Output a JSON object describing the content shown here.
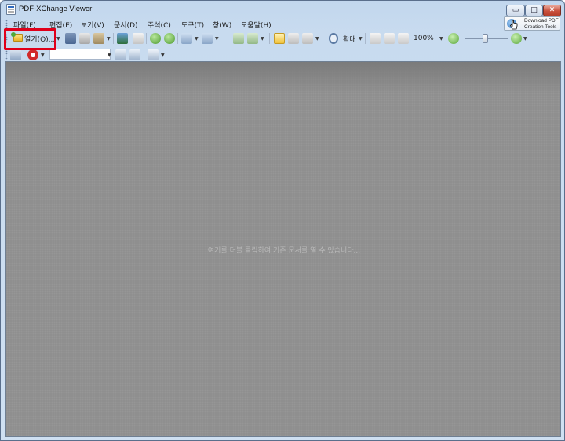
{
  "window": {
    "title": "PDF-XChange Viewer",
    "min_symbol": "▭",
    "max_symbol": "□",
    "close_symbol": "✕"
  },
  "promo": {
    "text": "Download PDF Creation Tools"
  },
  "menu": {
    "items": [
      "파일(F)",
      "편집(E)",
      "보기(V)",
      "문서(D)",
      "주석(C)",
      "도구(T)",
      "창(W)",
      "도움말(H)"
    ]
  },
  "toolbar": {
    "open_label": "열기(O)...",
    "zoom_tool_label": "확대",
    "zoom_value": "100%",
    "search_value": ""
  },
  "workspace": {
    "hint": "여기를 더블 클릭하여 기존 문서를 열 수 있습니다..."
  },
  "colors": {
    "highlight": "#e0001a",
    "workspace_bg": "#8f8f8f"
  }
}
